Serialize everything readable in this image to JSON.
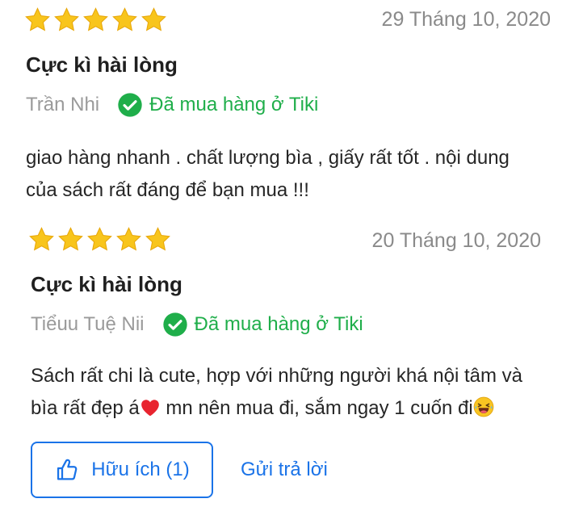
{
  "colors": {
    "star": "#f8c51c",
    "verified": "#1fae4a",
    "accent": "#1a73e8",
    "date": "#8a8a8a",
    "author": "#9a9a9a"
  },
  "reviews": [
    {
      "rating": 5,
      "date": "29 Tháng 10, 2020",
      "title": "Cực kì hài lòng",
      "author": "Trần Nhi",
      "verified_label": "Đã mua hàng ở Tiki",
      "content_lines": [
        "giao hàng nhanh . chất lượng bìa , giấy rất tốt . nội dung",
        "của sách rất đáng để bạn mua !!!"
      ]
    },
    {
      "rating": 5,
      "date": "20 Tháng 10, 2020",
      "title": "Cực kì hài lòng",
      "author": "Tiểuu Tuệ Nii",
      "verified_label": "Đã mua hàng ở Tiki",
      "content_lines": [
        "Sách rất chi là cute, hợp với những người khá nội tâm và",
        "bìa rất đẹp á",
        " mn nên mua đi, sắm ngay 1 cuốn đi"
      ],
      "emojis": [
        "heart-emoji",
        "laughing-emoji"
      ]
    }
  ],
  "actions": {
    "helpful_label": "Hữu ích (1)",
    "reply_label": "Gửi trả lời",
    "icon": "thumbs-up-icon"
  }
}
